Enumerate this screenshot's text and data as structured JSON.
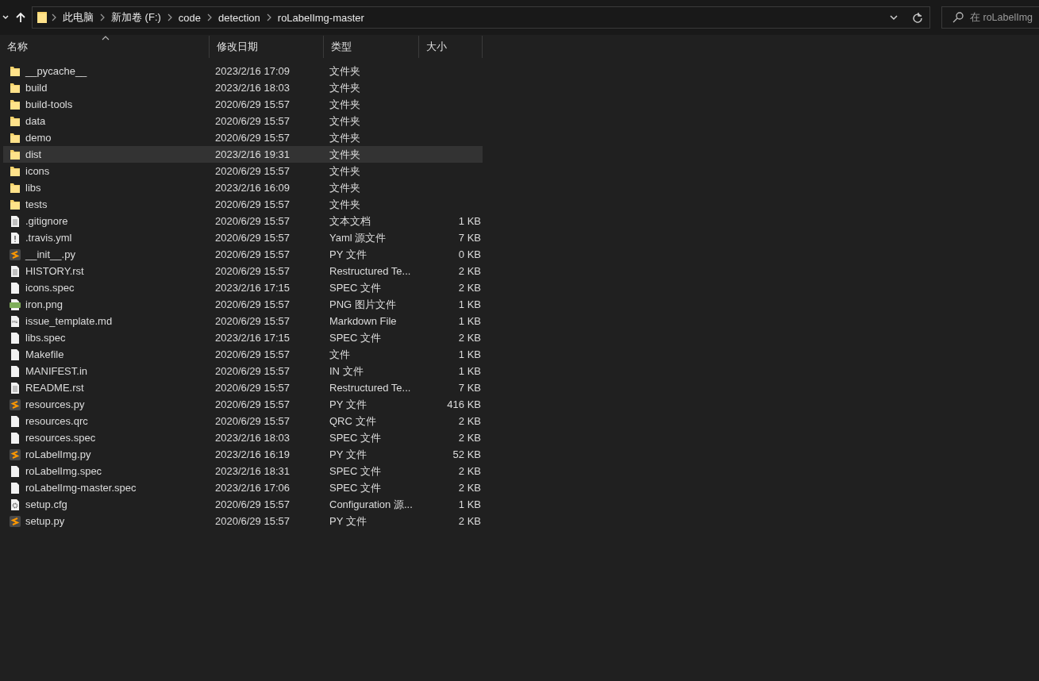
{
  "address_bar": {
    "path": [
      "此电脑",
      "新加卷 (F:)",
      "code",
      "detection",
      "roLabelImg-master"
    ]
  },
  "search": {
    "placeholder": "在 roLabelImg"
  },
  "columns": [
    {
      "label": "名称",
      "sorted": true
    },
    {
      "label": "修改日期",
      "sorted": false
    },
    {
      "label": "类型",
      "sorted": false
    },
    {
      "label": "大小",
      "sorted": false
    }
  ],
  "files": [
    {
      "kind": "folder",
      "name": "__pycache__",
      "date": "2023/2/16 17:09",
      "type": "文件夹",
      "selected": false
    },
    {
      "kind": "folder",
      "name": "build",
      "date": "2023/2/16 18:03",
      "type": "文件夹",
      "selected": false
    },
    {
      "kind": "folder",
      "name": "build-tools",
      "date": "2020/6/29 15:57",
      "type": "文件夹",
      "selected": false
    },
    {
      "kind": "folder",
      "name": "data",
      "date": "2020/6/29 15:57",
      "type": "文件夹",
      "selected": false
    },
    {
      "kind": "folder",
      "name": "demo",
      "date": "2020/6/29 15:57",
      "type": "文件夹",
      "selected": false
    },
    {
      "kind": "folder",
      "name": "dist",
      "date": "2023/2/16 19:31",
      "type": "文件夹",
      "selected": true
    },
    {
      "kind": "folder",
      "name": "icons",
      "date": "2020/6/29 15:57",
      "type": "文件夹",
      "selected": false
    },
    {
      "kind": "folder",
      "name": "libs",
      "date": "2023/2/16 16:09",
      "type": "文件夹",
      "selected": false
    },
    {
      "kind": "folder",
      "name": "tests",
      "date": "2020/6/29 15:57",
      "type": "文件夹",
      "selected": false
    },
    {
      "kind": "text",
      "name": ".gitignore",
      "date": "2020/6/29 15:57",
      "type": "文本文档",
      "size": "1 KB",
      "selected": false
    },
    {
      "kind": "yaml",
      "name": ".travis.yml",
      "date": "2020/6/29 15:57",
      "type": "Yaml 源文件",
      "size": "7 KB",
      "selected": false
    },
    {
      "kind": "python",
      "name": "__init__.py",
      "date": "2020/6/29 15:57",
      "type": "PY 文件",
      "size": "0 KB",
      "selected": false
    },
    {
      "kind": "text",
      "name": "HISTORY.rst",
      "date": "2020/6/29 15:57",
      "type": "Restructured Te...",
      "size": "2 KB",
      "selected": false
    },
    {
      "kind": "blank",
      "name": "icons.spec",
      "date": "2023/2/16 17:15",
      "type": "SPEC 文件",
      "size": "2 KB",
      "selected": false
    },
    {
      "kind": "image",
      "name": "iron.png",
      "date": "2020/6/29 15:57",
      "type": "PNG 图片文件",
      "size": "1 KB",
      "selected": false
    },
    {
      "kind": "markdown",
      "name": "issue_template.md",
      "date": "2020/6/29 15:57",
      "type": "Markdown File",
      "size": "1 KB",
      "selected": false
    },
    {
      "kind": "blank",
      "name": "libs.spec",
      "date": "2023/2/16 17:15",
      "type": "SPEC 文件",
      "size": "2 KB",
      "selected": false
    },
    {
      "kind": "blank",
      "name": "Makefile",
      "date": "2020/6/29 15:57",
      "type": "文件",
      "size": "1 KB",
      "selected": false
    },
    {
      "kind": "blank",
      "name": "MANIFEST.in",
      "date": "2020/6/29 15:57",
      "type": "IN 文件",
      "size": "1 KB",
      "selected": false
    },
    {
      "kind": "text",
      "name": "README.rst",
      "date": "2020/6/29 15:57",
      "type": "Restructured Te...",
      "size": "7 KB",
      "selected": false
    },
    {
      "kind": "python",
      "name": "resources.py",
      "date": "2020/6/29 15:57",
      "type": "PY 文件",
      "size": "416 KB",
      "selected": false
    },
    {
      "kind": "blank",
      "name": "resources.qrc",
      "date": "2020/6/29 15:57",
      "type": "QRC 文件",
      "size": "2 KB",
      "selected": false
    },
    {
      "kind": "blank",
      "name": "resources.spec",
      "date": "2023/2/16 18:03",
      "type": "SPEC 文件",
      "size": "2 KB",
      "selected": false
    },
    {
      "kind": "python",
      "name": "roLabelImg.py",
      "date": "2023/2/16 16:19",
      "type": "PY 文件",
      "size": "52 KB",
      "selected": false
    },
    {
      "kind": "blank",
      "name": "roLabelImg.spec",
      "date": "2023/2/16 18:31",
      "type": "SPEC 文件",
      "size": "2 KB",
      "selected": false
    },
    {
      "kind": "blank",
      "name": "roLabelImg-master.spec",
      "date": "2023/2/16 17:06",
      "type": "SPEC 文件",
      "size": "2 KB",
      "selected": false
    },
    {
      "kind": "config",
      "name": "setup.cfg",
      "date": "2020/6/29 15:57",
      "type": "Configuration 源...",
      "size": "1 KB",
      "selected": false
    },
    {
      "kind": "python",
      "name": "setup.py",
      "date": "2020/6/29 15:57",
      "type": "PY 文件",
      "size": "2 KB",
      "selected": false
    }
  ]
}
